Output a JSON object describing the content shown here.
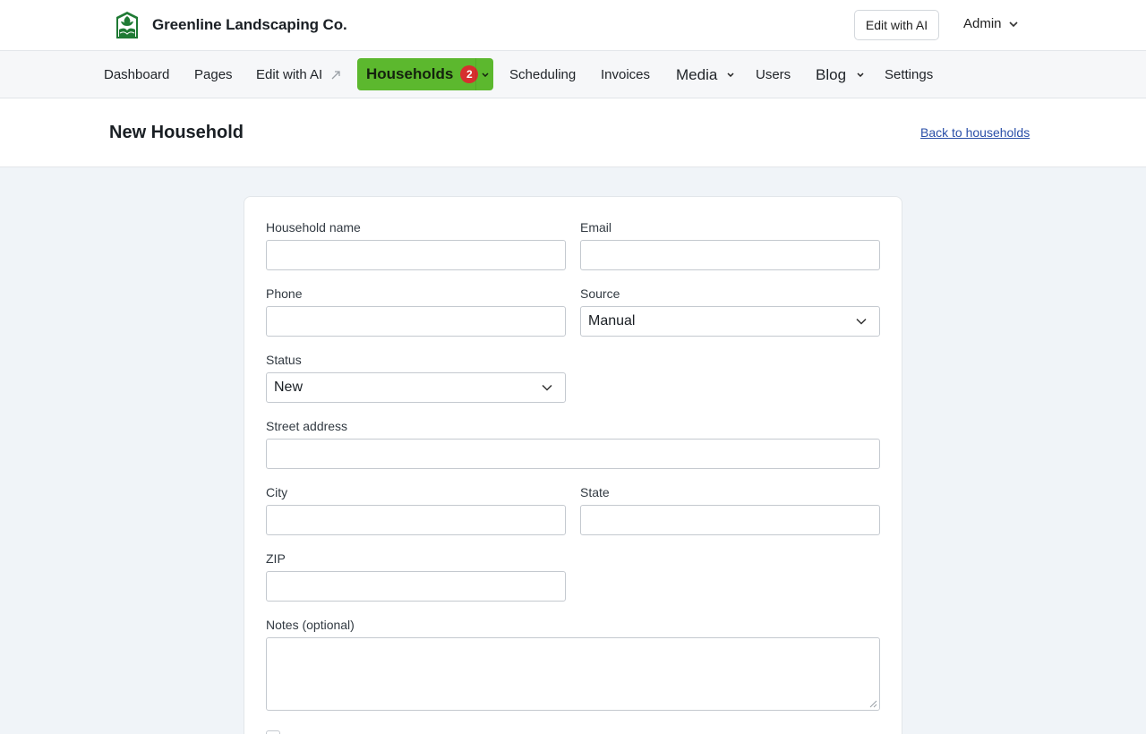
{
  "header": {
    "brand_name": "Greenline Landscaping Co.",
    "edit_ai_label": "Edit with AI",
    "admin_label": "Admin"
  },
  "nav": {
    "items": [
      {
        "label": "Dashboard"
      },
      {
        "label": "Pages"
      },
      {
        "label": "Edit with AI"
      },
      {
        "label": "Households",
        "badge": "2"
      },
      {
        "label": "Scheduling"
      },
      {
        "label": "Invoices"
      },
      {
        "label": "Media"
      },
      {
        "label": "Users"
      },
      {
        "label": "Blog"
      },
      {
        "label": "Settings"
      }
    ]
  },
  "page": {
    "title": "New Household",
    "back_link": "Back to households"
  },
  "form": {
    "household_name": {
      "label": "Household name",
      "value": ""
    },
    "email": {
      "label": "Email",
      "value": ""
    },
    "phone": {
      "label": "Phone",
      "value": ""
    },
    "source": {
      "label": "Source",
      "value": "Manual"
    },
    "status": {
      "label": "Status",
      "value": "New"
    },
    "street": {
      "label": "Street address",
      "value": ""
    },
    "city": {
      "label": "City",
      "value": ""
    },
    "state": {
      "label": "State",
      "value": ""
    },
    "zip": {
      "label": "ZIP",
      "value": ""
    },
    "notes": {
      "label": "Notes (optional)",
      "value": ""
    }
  },
  "colors": {
    "accent": "#5cb82e",
    "badge": "#d62f2f",
    "link": "#2a4fa8",
    "logo": "#1f7a34"
  },
  "icons": {
    "logo": "leaf-logo-icon",
    "chevron": "chevron-down-icon",
    "external": "arrow-up-right-icon"
  }
}
